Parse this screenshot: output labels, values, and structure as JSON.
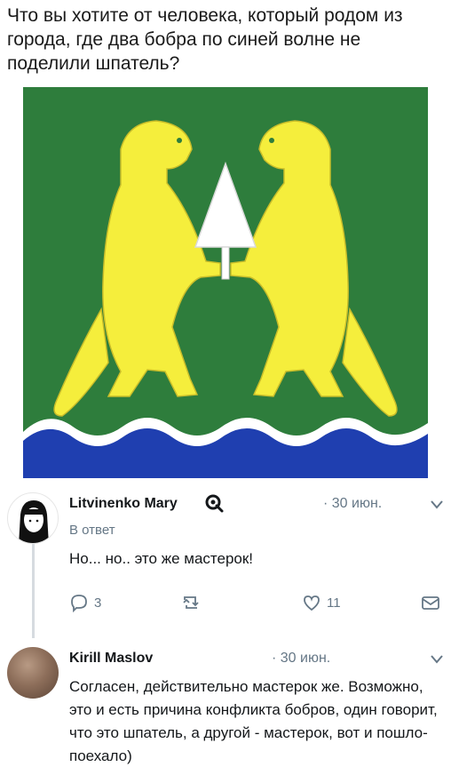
{
  "post": {
    "caption": "Что вы хотите от человека, который родом из города, где два бобра по синей волне не поделили шпатель?"
  },
  "tweets": [
    {
      "author": "Litvinenko Mary",
      "time": "· 30 июн.",
      "reply_label": "В ответ",
      "text": "Но... но.. это же мастерок!",
      "reply_count": "3",
      "retweet_count": "",
      "like_count": "11"
    },
    {
      "author": "Kirill Maslov",
      "time": "· 30 июн.",
      "text": "Согласен, действительно мастерок же. Возможно, это и есть причина конфликта бобров, один говорит, что это шпатель, а другой - мастерок, вот и пошло-поехало)"
    }
  ],
  "colors": {
    "field": "#2e7d3c",
    "beaver": "#f5ee3c",
    "wave_blue": "#1f3fb0",
    "muted": "#657786"
  }
}
